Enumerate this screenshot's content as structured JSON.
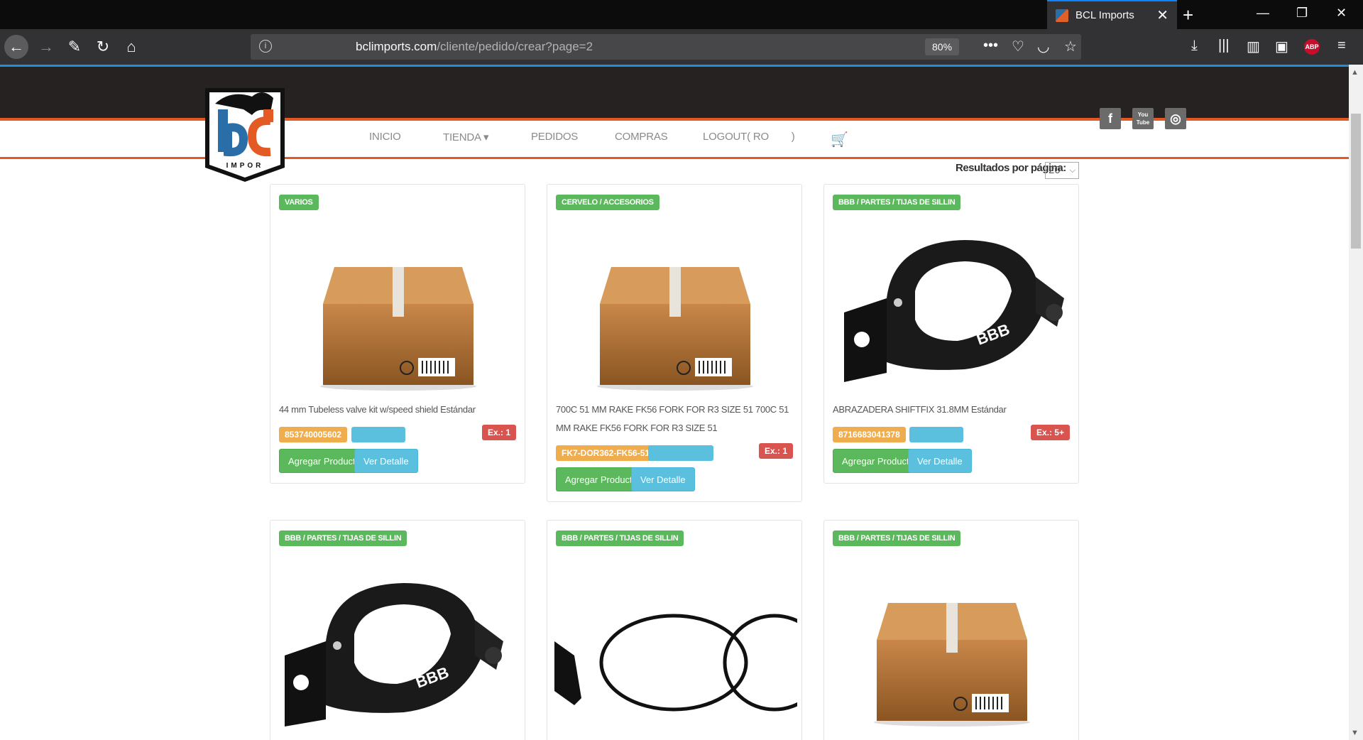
{
  "browser": {
    "tab_title": "BCL Imports",
    "url_domain": "bclimports.com",
    "url_path": "/cliente/pedido/crear?page=2",
    "zoom": "80%",
    "abp_label": "ABP"
  },
  "site": {
    "logo_text": "IMPOR",
    "nav": [
      "INICIO",
      "TIENDA ▾",
      "PEDIDOS",
      "COMPRAS",
      "LOGOUT( RO        )"
    ],
    "social": [
      "f",
      "You Tube",
      "◎"
    ],
    "per_page_label": "Resultados por página:",
    "per_page_value": "20"
  },
  "products": [
    {
      "category": "VARIOS",
      "image": "box",
      "name": "44 mm Tubeless valve kit w/speed shield Estándar",
      "sku": "853740005602",
      "stock": "Ex.: 1",
      "add_label": "Agregar Producto",
      "detail_label": "Ver Detalle"
    },
    {
      "category": "CERVELO / ACCESORIOS",
      "image": "box",
      "name": "700C 51 MM RAKE FK56 FORK FOR R3 SIZE 51 700C 51 MM RAKE FK56 FORK FOR R3 SIZE 51",
      "sku": "FK7-DOR362-FK56-51",
      "stock": "Ex.: 1",
      "add_label": "Agregar Producto",
      "detail_label": "Ver Detalle"
    },
    {
      "category": "BBB / PARTES / TIJAS DE SILLIN",
      "image": "clamp",
      "name": "ABRAZADERA SHIFTFIX 31.8MM Estándar",
      "sku": "8716683041378",
      "stock": "Ex.: 5+",
      "add_label": "Agregar Producto",
      "detail_label": "Ver Detalle"
    },
    {
      "category": "BBB / PARTES / TIJAS DE SILLIN",
      "image": "clamp"
    },
    {
      "category": "BBB / PARTES / TIJAS DE SILLIN",
      "image": "orings"
    },
    {
      "category": "BBB / PARTES / TIJAS DE SILLIN",
      "image": "box"
    }
  ],
  "colors": {
    "category_green": "#5cb85c",
    "sku_orange": "#f0ad4e",
    "stock_red": "#d9534f",
    "info_blue": "#5bc0de",
    "brand_orange": "#e45a24",
    "header_dark": "#272222"
  }
}
